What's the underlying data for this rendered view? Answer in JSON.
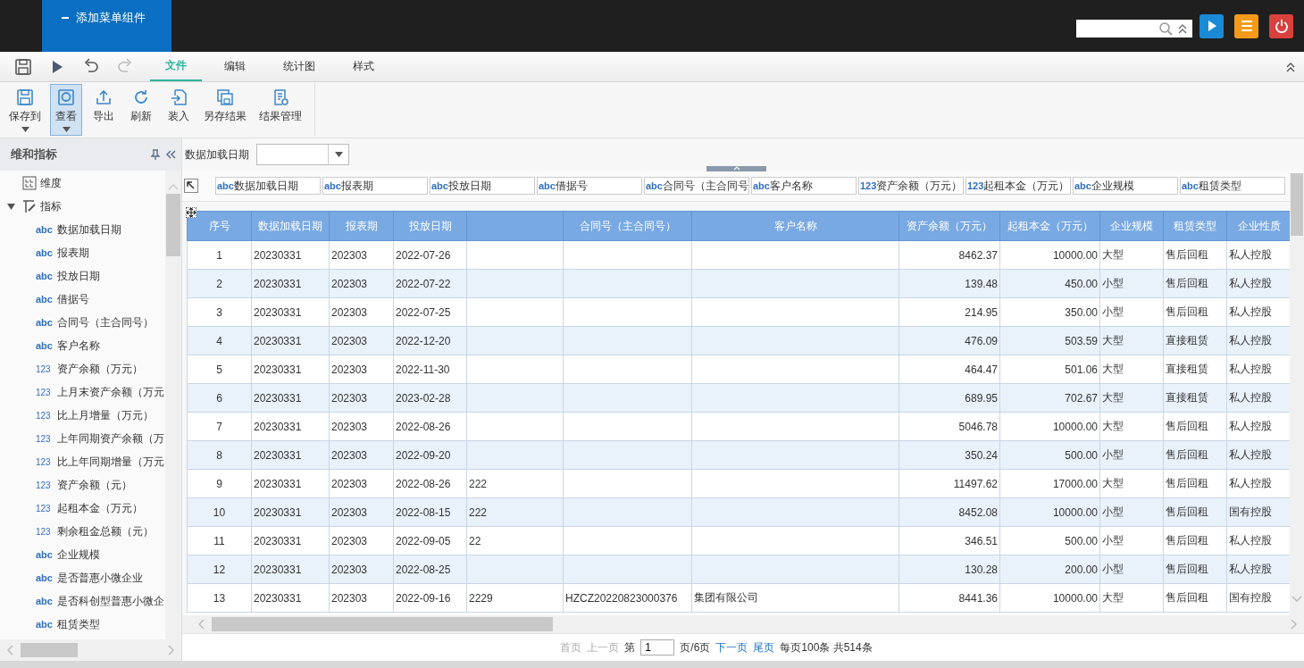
{
  "header": {
    "menu_tab": "添加菜单组件"
  },
  "tabs": [
    {
      "label": "文件",
      "selected": true
    },
    {
      "label": "编辑",
      "selected": false
    },
    {
      "label": "统计图",
      "selected": false
    },
    {
      "label": "样式",
      "selected": false
    }
  ],
  "ribbon": [
    {
      "label": "保存到",
      "kind": "save",
      "dropdown": true,
      "selected": false
    },
    {
      "label": "查看",
      "kind": "view",
      "dropdown": true,
      "selected": true
    },
    {
      "label": "导出",
      "kind": "export",
      "dropdown": false,
      "selected": false
    },
    {
      "label": "刷新",
      "kind": "refresh",
      "dropdown": false,
      "selected": false
    },
    {
      "label": "装入",
      "kind": "load",
      "dropdown": false,
      "selected": false
    },
    {
      "label": "另存结果",
      "kind": "save-as",
      "dropdown": false,
      "selected": false
    },
    {
      "label": "结果管理",
      "kind": "manage",
      "dropdown": false,
      "selected": false
    }
  ],
  "sidebar": {
    "title": "维和指标",
    "tree": [
      {
        "label": "维度",
        "kind": "dimension"
      },
      {
        "label": "指标",
        "kind": "measure",
        "expanded": true,
        "children": [
          {
            "badge": "abc",
            "label": "数据加载日期"
          },
          {
            "badge": "abc",
            "label": "报表期"
          },
          {
            "badge": "abc",
            "label": "投放日期"
          },
          {
            "badge": "abc",
            "label": "借据号"
          },
          {
            "badge": "abc",
            "label": "合同号（主合同号）"
          },
          {
            "badge": "abc",
            "label": "客户名称"
          },
          {
            "badge": "123",
            "label": "资产余额（万元）"
          },
          {
            "badge": "123",
            "label": "上月末资产余额（万元"
          },
          {
            "badge": "123",
            "label": "比上月增量（万元）"
          },
          {
            "badge": "123",
            "label": "上年同期资产余额（万"
          },
          {
            "badge": "123",
            "label": "比上年同期增量（万元"
          },
          {
            "badge": "123",
            "label": "资产余额（元）"
          },
          {
            "badge": "123",
            "label": "起租本金（万元）"
          },
          {
            "badge": "123",
            "label": "剩余租金总额（元）"
          },
          {
            "badge": "abc",
            "label": "企业规模"
          },
          {
            "badge": "abc",
            "label": "是否普惠小微企业"
          },
          {
            "badge": "abc",
            "label": "是否科创型普惠小微企"
          },
          {
            "badge": "abc",
            "label": "租赁类型"
          }
        ]
      }
    ]
  },
  "filter": {
    "label": "数据加载日期"
  },
  "fields": [
    {
      "badge": "abc",
      "label": "数据加载日期"
    },
    {
      "badge": "abc",
      "label": "报表期"
    },
    {
      "badge": "abc",
      "label": "投放日期"
    },
    {
      "badge": "abc",
      "label": "借据号"
    },
    {
      "badge": "abc",
      "label": "合同号（主合同号"
    },
    {
      "badge": "abc",
      "label": "客户名称"
    },
    {
      "badge": "123",
      "label": "资产余额（万元）"
    },
    {
      "badge": "123",
      "label": "起租本金（万元）"
    },
    {
      "badge": "abc",
      "label": "企业规模"
    },
    {
      "badge": "abc",
      "label": "租赁类型"
    }
  ],
  "table": {
    "columns": [
      "序号",
      "数据加载日期",
      "报表期",
      "投放日期",
      null,
      "合同号（主合同号）",
      "客户名称",
      "资产余额（万元）",
      "起租本金（万元）",
      "企业规模",
      "租赁类型",
      "企业性质"
    ],
    "rows": [
      [
        "1",
        "20230331",
        "202303",
        "2022-07-26",
        null,
        null,
        null,
        "8462.37",
        "10000.00",
        "大型",
        "售后回租",
        "私人控股"
      ],
      [
        "2",
        "20230331",
        "202303",
        "2022-07-22",
        null,
        null,
        null,
        "139.48",
        "450.00",
        "小型",
        "售后回租",
        "私人控股"
      ],
      [
        "3",
        "20230331",
        "202303",
        "2022-07-25",
        null,
        null,
        null,
        "214.95",
        "350.00",
        "小型",
        "售后回租",
        "私人控股"
      ],
      [
        "4",
        "20230331",
        "202303",
        "2022-12-20",
        null,
        null,
        null,
        "476.09",
        "503.59",
        "大型",
        "直接租赁",
        "私人控股"
      ],
      [
        "5",
        "20230331",
        "202303",
        "2022-11-30",
        null,
        null,
        null,
        "464.47",
        "501.06",
        "大型",
        "直接租赁",
        "私人控股"
      ],
      [
        "6",
        "20230331",
        "202303",
        "2023-02-28",
        null,
        null,
        null,
        "689.95",
        "702.67",
        "大型",
        "直接租赁",
        "私人控股"
      ],
      [
        "7",
        "20230331",
        "202303",
        "2022-08-26",
        null,
        null,
        null,
        "5046.78",
        "10000.00",
        "大型",
        "售后回租",
        "私人控股"
      ],
      [
        "8",
        "20230331",
        "202303",
        "2022-09-20",
        null,
        null,
        null,
        "350.24",
        "500.00",
        "小型",
        "售后回租",
        "私人控股"
      ],
      [
        "9",
        "20230331",
        "202303",
        "2022-08-26",
        "222",
        null,
        null,
        "11497.62",
        "17000.00",
        "大型",
        "售后回租",
        "私人控股"
      ],
      [
        "10",
        "20230331",
        "202303",
        "2022-08-15",
        "222",
        null,
        null,
        "8452.08",
        "10000.00",
        "小型",
        "售后回租",
        "国有控股"
      ],
      [
        "11",
        "20230331",
        "202303",
        "2022-09-05",
        "22",
        null,
        null,
        "346.51",
        "500.00",
        "小型",
        "售后回租",
        "私人控股"
      ],
      [
        "12",
        "20230331",
        "202303",
        "2022-08-25",
        null,
        null,
        null,
        "130.28",
        "200.00",
        "小型",
        "售后回租",
        "私人控股"
      ],
      [
        "13",
        "20230331",
        "202303",
        "2022-09-16",
        "2229",
        "HZCZ20220823000376",
        "集团有限公司",
        "8441.36",
        "10000.00",
        "大型",
        "售后回租",
        "国有控股"
      ]
    ]
  },
  "pager": {
    "before": [
      {
        "label": "首页",
        "disabled": true
      },
      {
        "label": "上一页",
        "disabled": true
      }
    ],
    "page_prefix": "第",
    "page": "1",
    "page_suffix": "页/6页",
    "after": [
      {
        "label": "下一页",
        "disabled": false
      },
      {
        "label": "尾页",
        "disabled": false
      }
    ],
    "summary": "每页100条 共514条"
  }
}
